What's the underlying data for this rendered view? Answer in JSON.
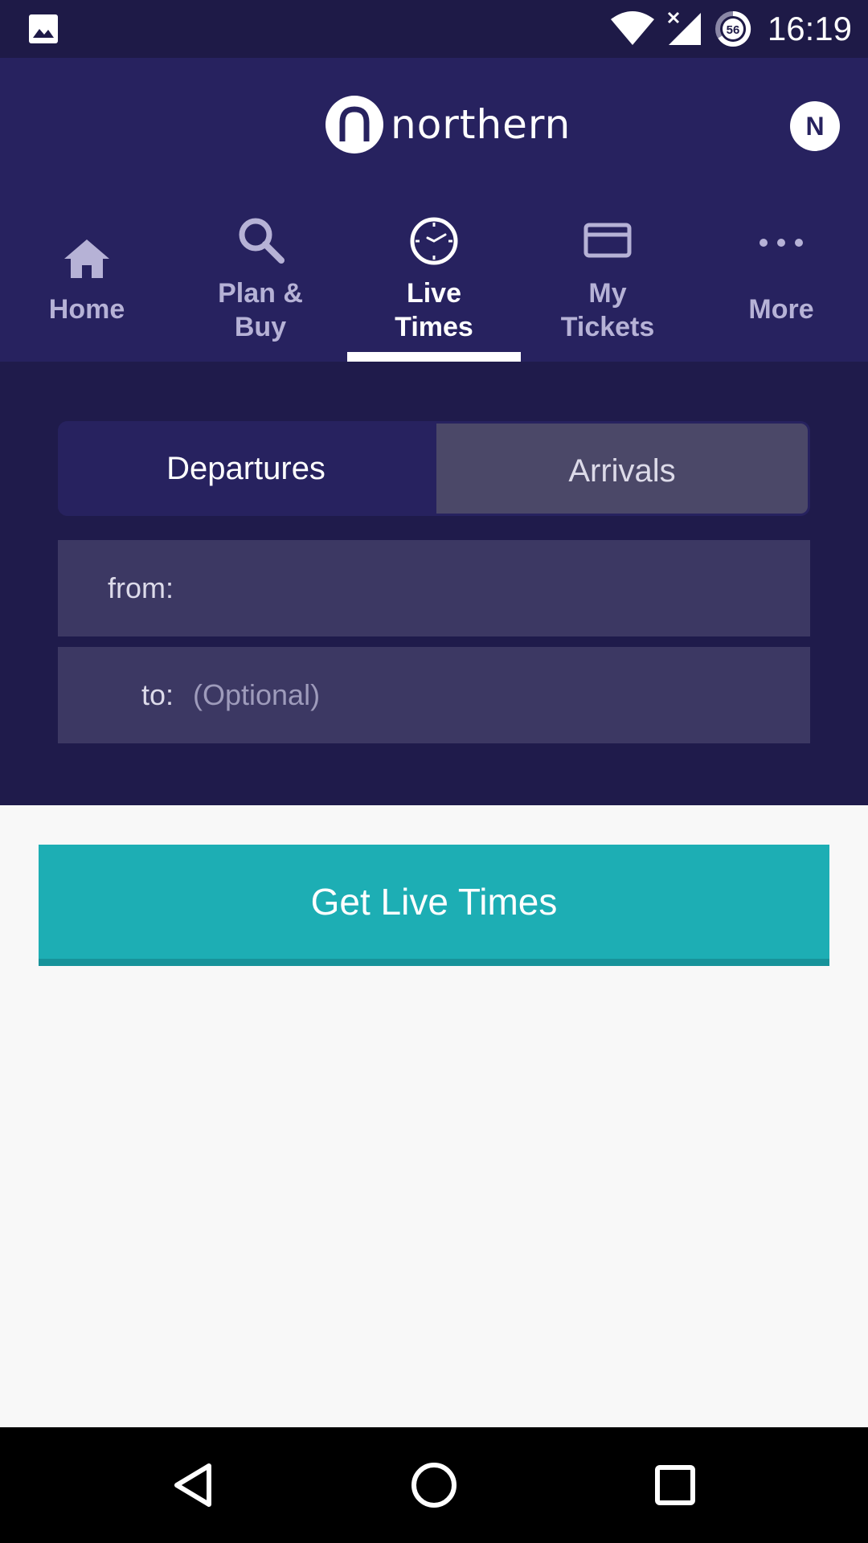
{
  "status_bar": {
    "time": "16:19",
    "battery_level": "56",
    "icons": [
      "gallery-icon",
      "wifi-icon",
      "signal-icon",
      "battery-saver-icon"
    ]
  },
  "header": {
    "brand": "northern",
    "avatar_initial": "N"
  },
  "nav": {
    "items": [
      {
        "label": "Home",
        "icon": "home-icon",
        "active": false
      },
      {
        "label": "Plan &",
        "label2": "Buy",
        "icon": "search-icon",
        "active": false
      },
      {
        "label": "Live",
        "label2": "Times",
        "icon": "clock-icon",
        "active": true
      },
      {
        "label": "My",
        "label2": "Tickets",
        "icon": "ticket-icon",
        "active": false
      },
      {
        "label": "More",
        "icon": "more-icon",
        "active": false
      }
    ]
  },
  "search": {
    "tabs": {
      "departures": "Departures",
      "arrivals": "Arrivals",
      "selected": "Departures"
    },
    "from_label": "from:",
    "from_value": "",
    "to_label": "to:",
    "to_placeholder": "(Optional)"
  },
  "cta": {
    "label": "Get Live Times"
  },
  "colors": {
    "status_bar": "#1e1a47",
    "header": "#27225f",
    "panel": "#1f1b4b",
    "field": "#3c3863",
    "accent": "#1daeb4",
    "background": "#f8f8f8"
  }
}
